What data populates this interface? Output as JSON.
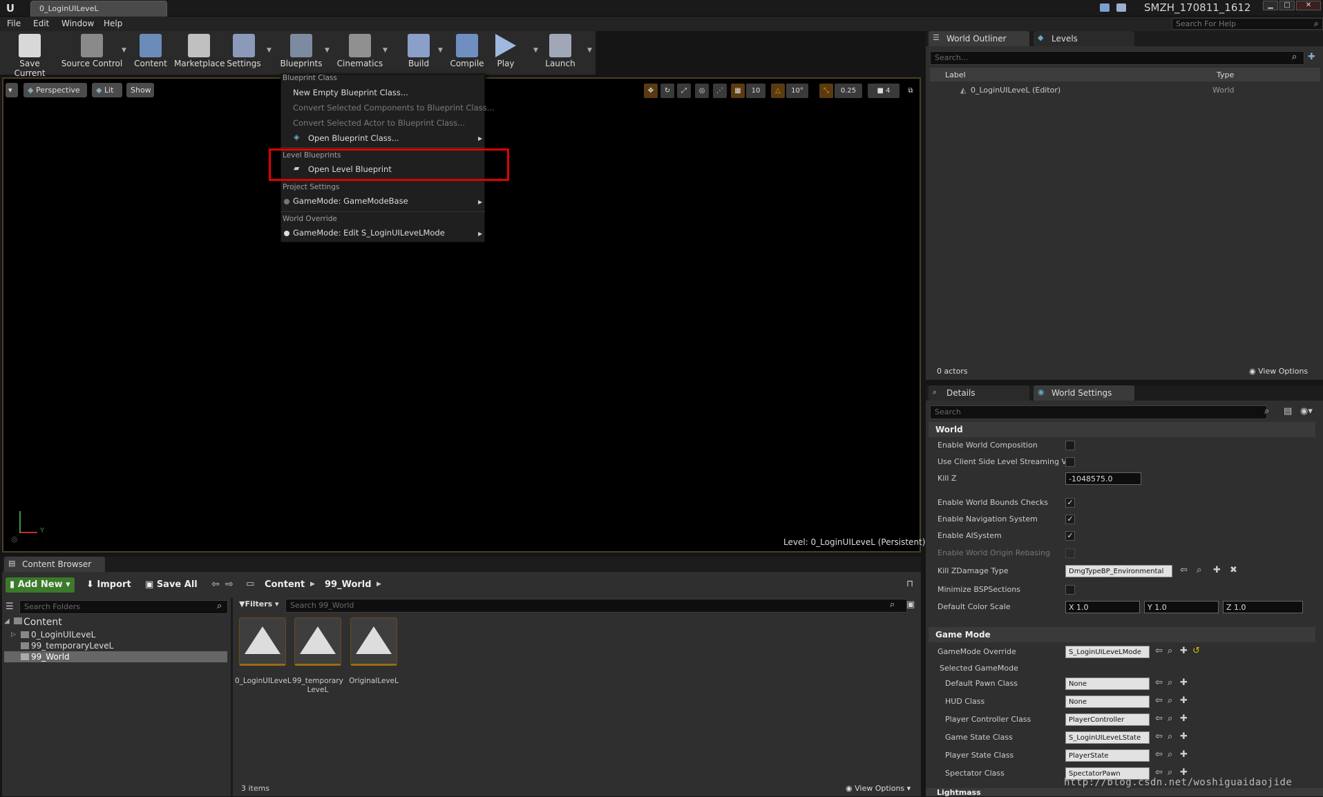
{
  "window": {
    "tab_title": "0_LoginUILeveL",
    "project_name": "SMZH_170811_1612",
    "help_search_placeholder": "Search For Help"
  },
  "menu": [
    "File",
    "Edit",
    "Window",
    "Help"
  ],
  "toolbar": [
    {
      "label": "Save Current",
      "icon": "save-icon",
      "color": "#d8d8d8"
    },
    {
      "label": "Source Control",
      "icon": "source-control-icon",
      "color": "#8a8a8a"
    },
    {
      "label": "Content",
      "icon": "content-icon",
      "color": "#6b8bb8"
    },
    {
      "label": "Marketplace",
      "icon": "marketplace-icon",
      "color": "#c0c0c0"
    },
    {
      "label": "Settings",
      "icon": "settings-icon",
      "color": "#8a9ab8"
    },
    {
      "label": "Blueprints",
      "icon": "blueprints-icon",
      "color": "#7d8ba0"
    },
    {
      "label": "Cinematics",
      "icon": "cinematics-icon",
      "color": "#909090"
    },
    {
      "label": "Build",
      "icon": "build-icon",
      "color": "#8aa0c8"
    },
    {
      "label": "Compile",
      "icon": "compile-icon",
      "color": "#6f8fc0"
    },
    {
      "label": "Play",
      "icon": "play-icon",
      "color": "#9eb8e0"
    },
    {
      "label": "Launch",
      "icon": "launch-icon",
      "color": "#a0a8b8"
    }
  ],
  "viewport": {
    "perspective": "Perspective",
    "lit": "Lit",
    "show": "Show",
    "grid_snap": "10",
    "rot_snap": "10°",
    "scale_snap": "0.25",
    "cam_speed": "4",
    "level_label": "Level:  0_LoginUILeveL (Persistent)"
  },
  "blueprints_menu": {
    "section_blueprint_class": "Blueprint Class",
    "new_empty": "New Empty Blueprint Class...",
    "convert_components": "Convert Selected Components to Blueprint Class...",
    "convert_actor": "Convert Selected Actor to Blueprint Class...",
    "open_blueprint_class": "Open Blueprint Class...",
    "section_level": "Level Blueprints",
    "open_level_blueprint": "Open Level Blueprint",
    "section_project": "Project Settings",
    "gamemode_base": "GameMode: GameModeBase",
    "section_world": "World Override",
    "gamemode_edit": "GameMode: Edit S_LoginUILeveLMode"
  },
  "world_outliner": {
    "tab": "World Outliner",
    "tab2": "Levels",
    "search_placeholder": "Search...",
    "col_label": "Label",
    "col_type": "Type",
    "row_label": "0_LoginUILeveL (Editor)",
    "row_type": "World",
    "actors": "0 actors",
    "view_options": "View Options"
  },
  "details": {
    "tab": "Details",
    "tab2": "World Settings",
    "search_placeholder": "Search",
    "section_world": "World",
    "enable_world_composition": "Enable World Composition",
    "use_client_side": "Use Client Side Level Streaming Vo",
    "kill_z": "Kill Z",
    "kill_z_value": "-1048575.0",
    "enable_world_bounds": "Enable World Bounds Checks",
    "enable_navigation": "Enable Navigation System",
    "enable_ai": "Enable AISystem",
    "enable_origin_rebasing": "Enable World Origin Rebasing",
    "kill_zdamage_type": "Kill ZDamage Type",
    "kill_zdamage_value": "DmgTypeBP_Environmental",
    "minimize_bsp": "Minimize BSPSections",
    "default_color_scale": "Default Color Scale",
    "x": "X  1.0",
    "y": "Y  1.0",
    "z": "Z  1.0",
    "section_game_mode": "Game Mode",
    "gamemode_override": "GameMode Override",
    "gamemode_override_value": "S_LoginUILeveLMode",
    "selected_gamemode": "Selected GameMode",
    "default_pawn": "Default Pawn Class",
    "default_pawn_value": "None",
    "hud_class": "HUD Class",
    "hud_class_value": "None",
    "player_controller": "Player Controller Class",
    "player_controller_value": "PlayerController",
    "game_state": "Game State Class",
    "game_state_value": "S_LoginUILeveLState",
    "player_state": "Player State Class",
    "player_state_value": "PlayerState",
    "spectator": "Spectator Class",
    "spectator_value": "SpectatorPawn",
    "section_lightmass": "Lightmass"
  },
  "content_browser": {
    "tab": "Content Browser",
    "add_new": "Add New",
    "import": "Import",
    "save_all": "Save All",
    "path_content": "Content",
    "path_world": "99_World",
    "search_folders": "Search Folders",
    "filters": "Filters",
    "search_assets": "Search 99_World",
    "folders": [
      "Content",
      "0_LoginUILeveL",
      "99_temporaryLeveL",
      "99_World"
    ],
    "assets": [
      "0_LoginUILeveL",
      "99_temporary LeveL",
      "OriginalLeveL"
    ],
    "items_count": "3 items",
    "view_options": "View Options"
  },
  "watermark": "http://blog.csdn.net/woshiguaidaojide",
  "colors": {
    "highlight": "#e00000",
    "asset_border": "#9a6b10"
  }
}
